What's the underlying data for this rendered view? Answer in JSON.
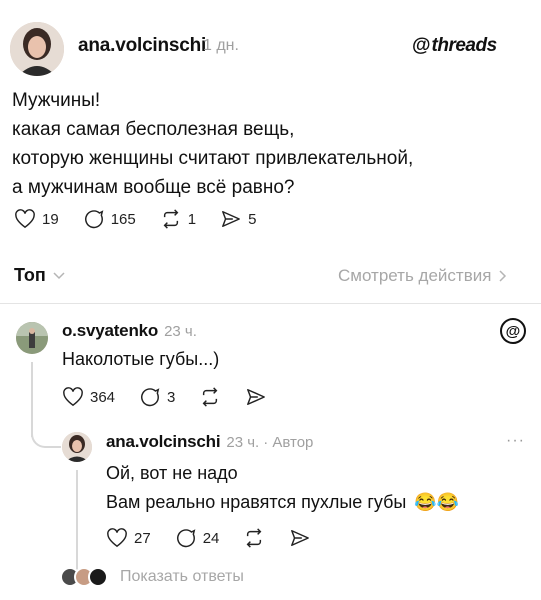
{
  "post": {
    "author": "ana.volcinschi",
    "time": "1 дн.",
    "brand": "threads",
    "lines": [
      "Мужчины!",
      "какая самая бесполезная вещь,",
      "которую женщины считают привлекательной,",
      "а мужчинам вообще всё равно?"
    ],
    "likes": "19",
    "replies": "165",
    "reposts": "1",
    "shares": "5"
  },
  "sort": {
    "label": "Топ",
    "activity_link": "Смотреть действия"
  },
  "comment": {
    "author": "o.svyatenko",
    "time": "23 ч.",
    "text": "Наколотые губы...)",
    "likes": "364",
    "replies": "3"
  },
  "reply": {
    "author": "ana.volcinschi",
    "time": "23 ч.",
    "badge": "· Автор",
    "line1": "Ой, вот не надо",
    "line2": "Вам реально нравятся пухлые губы",
    "emoji": "😂😂",
    "likes": "27",
    "replies": "24",
    "more": "···"
  },
  "show_replies": "Показать ответы"
}
